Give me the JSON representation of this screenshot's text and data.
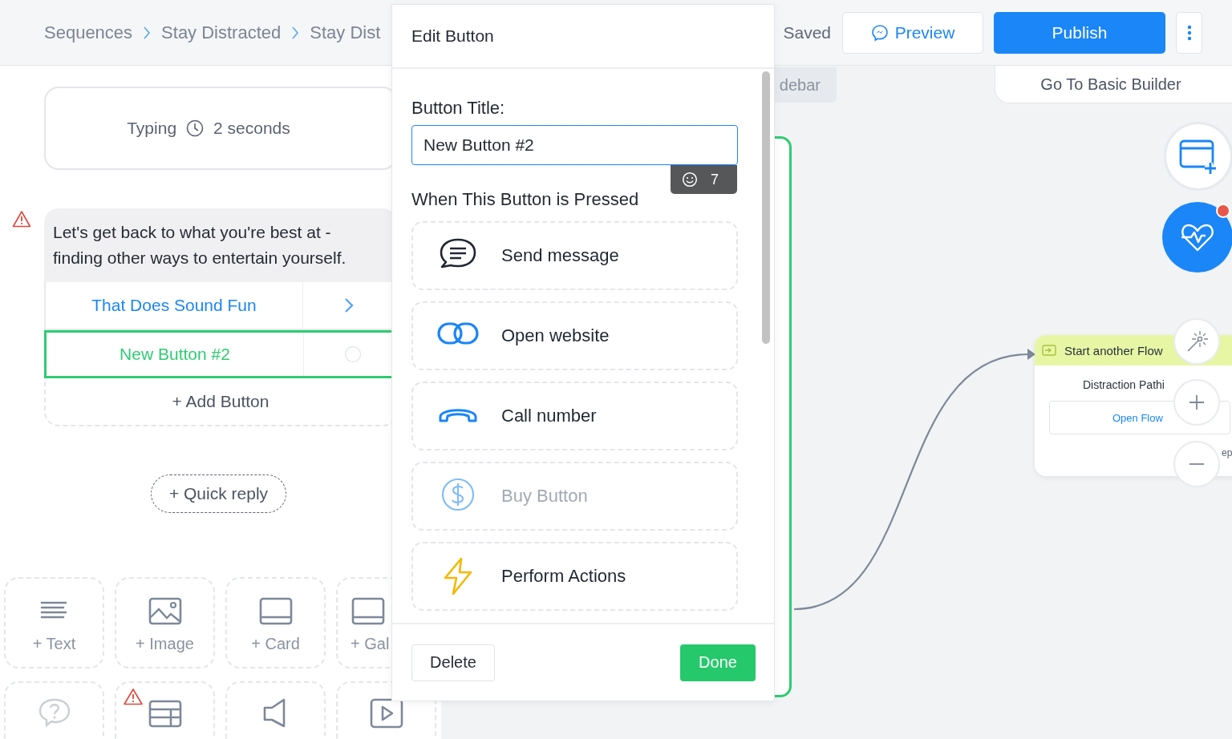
{
  "breadcrumb": [
    {
      "label": "Sequences"
    },
    {
      "label": "Stay Distracted"
    },
    {
      "label": "Stay Dist"
    }
  ],
  "save_status": "Saved",
  "header_buttons": {
    "preview": "Preview",
    "publish": "Publish"
  },
  "typing": {
    "label": "Typing",
    "duration": "2 seconds"
  },
  "message": {
    "warning": true,
    "text": "Let's get back to what you're best at - finding other ways to entertain yourself.",
    "buttons": [
      {
        "label": "That Does Sound Fun",
        "selected": false,
        "linked": true
      },
      {
        "label": "New Button #2",
        "selected": true,
        "linked": false
      }
    ],
    "add_button": "+ Add Button"
  },
  "quick_reply": "+ Quick reply",
  "blocks": [
    {
      "kind": "text",
      "label": "+ Text",
      "warning": false,
      "disabled": false
    },
    {
      "kind": "image",
      "label": "+ Image",
      "warning": false,
      "disabled": false
    },
    {
      "kind": "card",
      "label": "+ Card",
      "warning": false,
      "disabled": false
    },
    {
      "kind": "gallery",
      "label": "+ Gal",
      "warning": false,
      "disabled": false
    },
    {
      "kind": "question",
      "warning": false,
      "disabled": true
    },
    {
      "kind": "table",
      "warning": true,
      "disabled": false
    },
    {
      "kind": "audio",
      "warning": false,
      "disabled": false
    },
    {
      "kind": "video",
      "warning": false,
      "disabled": false
    }
  ],
  "dialog": {
    "title": "Edit Button",
    "field_label": "Button Title:",
    "field_value": "New Button #2",
    "char_count": "7",
    "section_title": "When This Button is Pressed",
    "actions": [
      {
        "kind": "message",
        "label": "Send message",
        "disabled": false
      },
      {
        "kind": "link",
        "label": "Open website",
        "disabled": false
      },
      {
        "kind": "phone",
        "label": "Call number",
        "disabled": false
      },
      {
        "kind": "dollar",
        "label": "Buy Button",
        "disabled": true
      },
      {
        "kind": "bolt",
        "label": "Perform Actions",
        "disabled": false
      }
    ],
    "delete": "Delete",
    "done": "Done"
  },
  "canvas": {
    "sidebar_button": "debar",
    "basic_builder": "Go To Basic Builder",
    "health_alert": true,
    "node": {
      "title": "Start another Flow",
      "flow_name": "Distraction Pathi",
      "open": "Open Flow",
      "fragment": "ep"
    }
  }
}
